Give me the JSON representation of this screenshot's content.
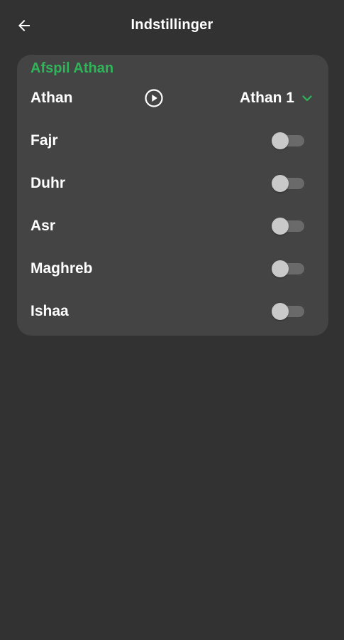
{
  "header": {
    "title": "Indstillinger",
    "back_icon": "arrow-back-icon"
  },
  "card": {
    "section_title": "Afspil Athan",
    "athan_row": {
      "label": "Athan",
      "play_icon": "play-circle-icon",
      "selected_value": "Athan 1",
      "dropdown_icon": "chevron-down-icon"
    },
    "prayers": [
      {
        "label": "Fajr",
        "enabled": false
      },
      {
        "label": "Duhr",
        "enabled": false
      },
      {
        "label": "Asr",
        "enabled": false
      },
      {
        "label": "Maghreb",
        "enabled": false
      },
      {
        "label": "Ishaa",
        "enabled": false
      }
    ]
  },
  "colors": {
    "background": "#323232",
    "card": "#444444",
    "accent": "#2fb45a",
    "text": "#ffffff",
    "toggle_off_track": "#6a6a6a",
    "toggle_off_thumb": "#c9c9c9"
  }
}
